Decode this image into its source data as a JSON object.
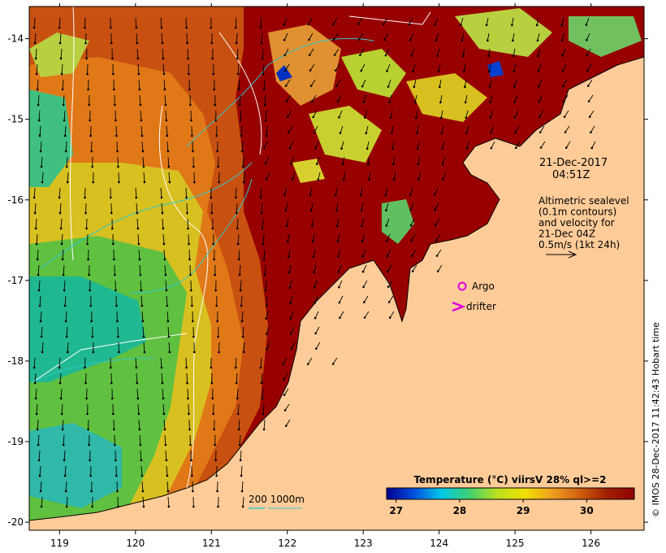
{
  "map": {
    "lon_range": [
      118.6,
      126.7
    ],
    "lat_range": [
      -20.1,
      -13.6
    ],
    "lon_ticks": [
      119,
      120,
      121,
      122,
      123,
      124,
      125,
      126
    ],
    "lat_ticks": [
      -14,
      -15,
      -16,
      -17,
      -18,
      -19,
      -20
    ]
  },
  "annotations": {
    "date": "21-Dec-2017",
    "time": "04:51Z",
    "legend_lines": [
      "Altimetric sealevel",
      "(0.1m contours)",
      "and velocity for",
      "21-Dec 04Z",
      "0.5m/s (1kt 24h)"
    ],
    "argo_label": "Argo",
    "drifter_label": "drifter",
    "depth_label": "200  1000m"
  },
  "colorbar": {
    "title": "Temperature (°C) viirsV 28% ql>=2",
    "ticks": [
      "27",
      "28",
      "29",
      "30"
    ],
    "stops": [
      "#000090",
      "#0050e0",
      "#00c8e8",
      "#40d070",
      "#b8e020",
      "#f0e000",
      "#f0a020",
      "#d06010",
      "#a02000",
      "#900000"
    ]
  },
  "copyright": "© IMOS 28-Dec-2017 11:42:43 Hobart time",
  "colors": {
    "land": "#ffcc99",
    "hot": "#980000",
    "contour": "#ffffff",
    "isobath": "#30c8c8",
    "argo": "#e000e0"
  }
}
